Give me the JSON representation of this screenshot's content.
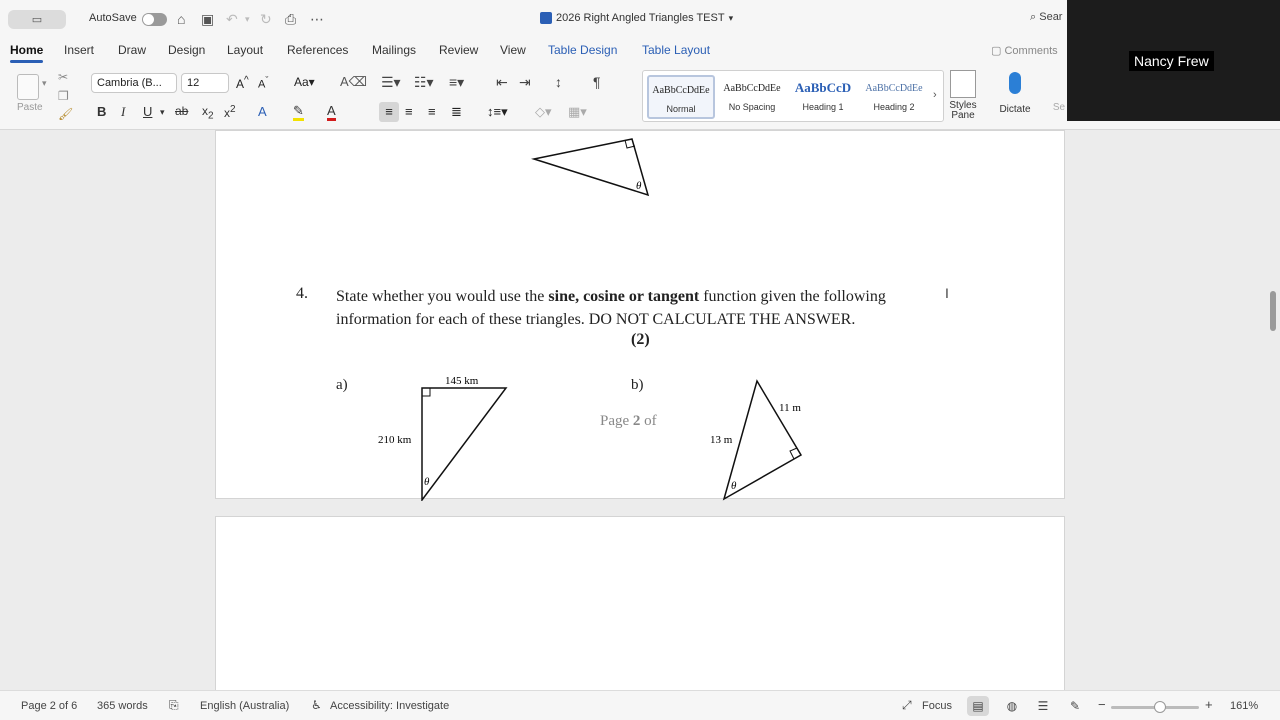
{
  "titlebar": {
    "autosave_label": "AutoSave",
    "doc_title": "2026 Right Angled Triangles TEST",
    "search_label": "Sear"
  },
  "tabs": [
    "Home",
    "Insert",
    "Draw",
    "Design",
    "Layout",
    "References",
    "Mailings",
    "Review",
    "View",
    "Table Design",
    "Table Layout"
  ],
  "comments_label": "Comments",
  "ribbon": {
    "paste_label": "Paste",
    "font_name": "Cambria (B...",
    "font_size": "12",
    "styles": [
      {
        "sample": "AaBbCcDdEe",
        "name": "Normal"
      },
      {
        "sample": "AaBbCcDdEe",
        "name": "No Spacing"
      },
      {
        "sample": "AaBbCcD",
        "name": "Heading 1"
      },
      {
        "sample": "AaBbCcDdEe",
        "name": "Heading 2"
      }
    ],
    "styles_pane_label": "Styles Pane",
    "dictate_label": "Dictate",
    "sensitivity_label": "Se"
  },
  "document": {
    "question_number": "4.",
    "q_part1": "State whether you would use the ",
    "q_bold": "sine, cosine or tangent",
    "q_part2": " function given the following information for each of these triangles. DO NOT CALCULATE THE ANSWER.",
    "marks": "(2)",
    "label_a": "a)",
    "label_b": "b)",
    "page_footer_prefix": "Page ",
    "page_footer_num": "2",
    "page_footer_suffix": " of",
    "tri_a": {
      "top": "145 km",
      "side": "210 km",
      "angle": "θ"
    },
    "tri_b": {
      "right": "11 m",
      "left": "13 m",
      "angle": "θ"
    },
    "tri_top_angle": "θ"
  },
  "video": {
    "participant": "Nancy Frew"
  },
  "status": {
    "page": "Page 2 of 6",
    "words": "365 words",
    "language": "English (Australia)",
    "accessibility": "Accessibility: Investigate",
    "focus": "Focus",
    "zoom": "161%"
  }
}
